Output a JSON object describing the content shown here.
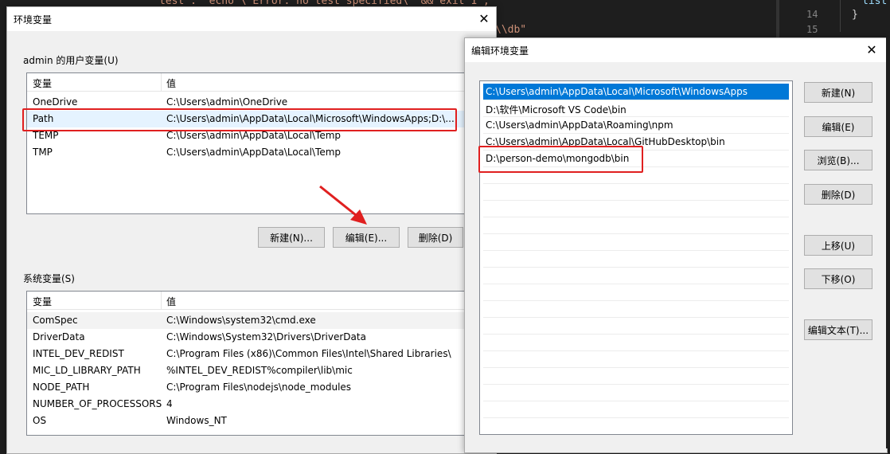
{
  "colors": {
    "selection": "#0078d7",
    "annotation_red": "#e02020",
    "editor_bg": "#1e1e1e"
  },
  "editor": {
    "code_top": "test\": \"echo \\\"Error: no test specified\\\" && exit 1\",",
    "code_db": "\\\\db\"",
    "line_numbers": [
      "14",
      "15"
    ],
    "right_code": [
      "list",
      "}"
    ]
  },
  "env_dialog": {
    "title": "环境变量",
    "user_group_label": "admin 的用户变量(U)",
    "user_columns": [
      "变量",
      "值"
    ],
    "user_vars": [
      {
        "name": "OneDrive",
        "value": "C:\\Users\\admin\\OneDrive"
      },
      {
        "name": "Path",
        "value": "C:\\Users\\admin\\AppData\\Local\\Microsoft\\WindowsApps;D:\\..."
      },
      {
        "name": "TEMP",
        "value": "C:\\Users\\admin\\AppData\\Local\\Temp"
      },
      {
        "name": "TMP",
        "value": "C:\\Users\\admin\\AppData\\Local\\Temp"
      }
    ],
    "user_buttons": {
      "new": "新建(N)...",
      "edit": "编辑(E)...",
      "delete": "删除(D)"
    },
    "system_group_label": "系统变量(S)",
    "system_columns": [
      "变量",
      "值"
    ],
    "system_vars": [
      {
        "name": "ComSpec",
        "value": "C:\\Windows\\system32\\cmd.exe"
      },
      {
        "name": "DriverData",
        "value": "C:\\Windows\\System32\\Drivers\\DriverData"
      },
      {
        "name": "INTEL_DEV_REDIST",
        "value": "C:\\Program Files (x86)\\Common Files\\Intel\\Shared Libraries\\"
      },
      {
        "name": "MIC_LD_LIBRARY_PATH",
        "value": "%INTEL_DEV_REDIST%compiler\\lib\\mic"
      },
      {
        "name": "NODE_PATH",
        "value": "C:\\Program Files\\nodejs\\node_modules"
      },
      {
        "name": "NUMBER_OF_PROCESSORS",
        "value": "4"
      },
      {
        "name": "OS",
        "value": "Windows_NT"
      }
    ]
  },
  "edit_dialog": {
    "title": "编辑环境变量",
    "paths": [
      "C:\\Users\\admin\\AppData\\Local\\Microsoft\\WindowsApps",
      "D:\\软件\\Microsoft VS Code\\bin",
      "C:\\Users\\admin\\AppData\\Roaming\\npm",
      "C:\\Users\\admin\\AppData\\Local\\GitHubDesktop\\bin",
      "D:\\person-demo\\mongodb\\bin"
    ],
    "buttons": {
      "new": "新建(N)",
      "edit": "编辑(E)",
      "browse": "浏览(B)...",
      "delete": "删除(D)",
      "move_up": "上移(U)",
      "move_down": "下移(O)",
      "edit_text": "编辑文本(T)..."
    }
  }
}
